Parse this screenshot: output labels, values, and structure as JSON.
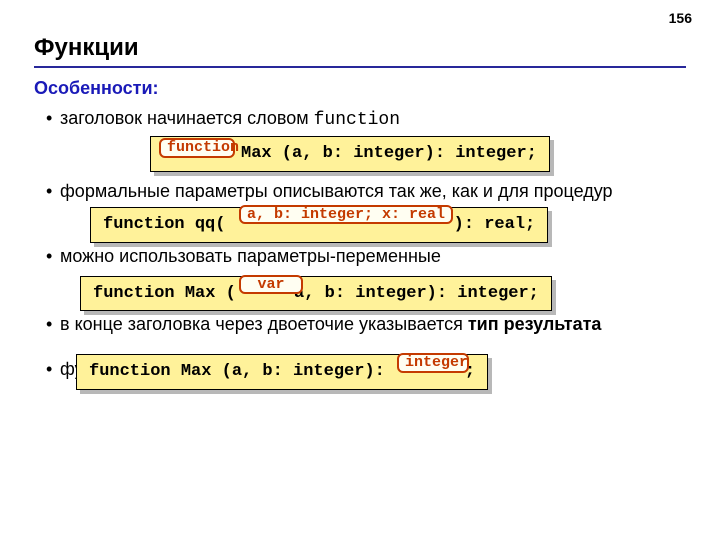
{
  "page_number": "156",
  "title": "Функции",
  "subhead": "Особенности:",
  "bullets": {
    "b1_text_a": "заголовок начинается словом ",
    "b1_code": "function",
    "b2_text": "формальные параметры описываются так же, как и для процедур",
    "b3_text": "можно использовать параметры-переменные",
    "b4_text_a": "в конце заголовка через двоеточие указывается ",
    "b4_text_b": "тип результата",
    "b5_text": "функ                                                               ммы"
  },
  "code1": {
    "hl": "function",
    "rest": " Max (a, b: integer): integer;"
  },
  "code2": {
    "prefix": "function qq( ",
    "hl": "a, b: integer; x: real",
    "suffix": "): real;"
  },
  "code3": {
    "prefix": "function Max (",
    "hl": "var",
    "suffix": " a, b: integer): integer;"
  },
  "code4": {
    "prefix": "function Max (a, b: integer):",
    "hl": "integer",
    "suffix": ";"
  }
}
